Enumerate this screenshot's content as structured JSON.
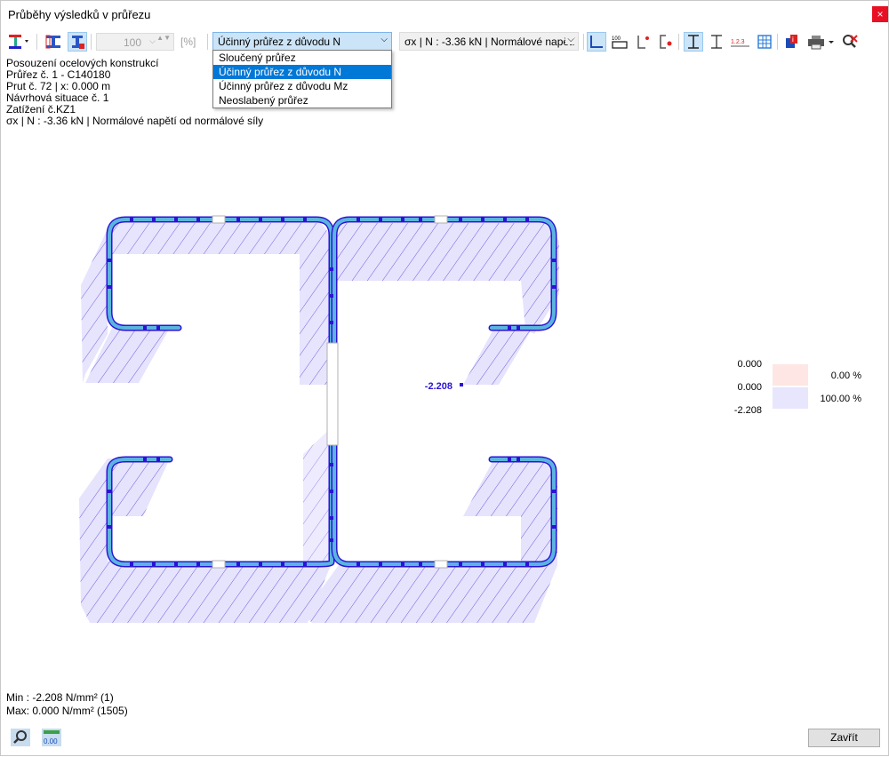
{
  "window": {
    "title": "Průběhy výsledků v průřezu",
    "close_glyph": "×"
  },
  "toolbar": {
    "scale_value": "100",
    "scale_unit": "[%]",
    "section_combo": "Účinný průřez z důvodu N",
    "result_combo": "σx | N : -3.36 kN | Normálové napětí od normálové síly",
    "dropdown_arrow": "⌵",
    "spin_updown": "▲▼",
    "table_label": "100",
    "numbering_label": "1.2.3"
  },
  "dropdown": {
    "options": [
      "Sloučený průřez",
      "Účinný průřez z důvodu N",
      "Účinný průřez z důvodu Mz",
      "Neoslabený průřez"
    ],
    "selected_index": 1
  },
  "info": {
    "lines": [
      "Posouzení ocelových konstrukcí",
      "Průřez č. 1 - C140180",
      "Prut č. 72 | x: 0.000 m",
      "Návrhová situace č. 1",
      "Zatížení č.KZ1",
      "σx | N : -3.36 kN | Normálové napětí od normálové síly"
    ]
  },
  "diagram": {
    "value_label": "-2.208"
  },
  "legend": {
    "values": [
      "0.000",
      "0.000",
      "-2.208"
    ],
    "items": [
      {
        "percent": "0.00 %",
        "color": "#fde6e3"
      },
      {
        "percent": "100.00 %",
        "color": "#e8e6fd"
      }
    ]
  },
  "minmax": {
    "min": "Min : -2.208 N/mm² (1)",
    "max": "Max:  0.000 N/mm² (1505)"
  },
  "bottom": {
    "close_label": "Zavřít",
    "decimals_label": "0.00"
  },
  "colors": {
    "accent": "#0078d7",
    "stress_fill": "#c9c3f7",
    "stress_edge": "#2a14d4",
    "steel": "#5bb4e0"
  }
}
